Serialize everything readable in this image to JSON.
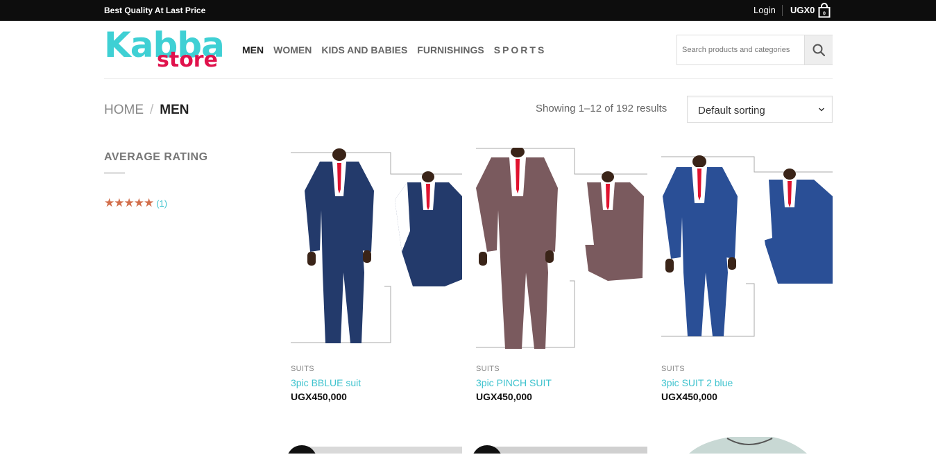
{
  "topbar": {
    "promo": "Best Quality At Last Price",
    "login": "Login",
    "cart_total": "UGX0",
    "cart_count": "0"
  },
  "logo": {
    "line1": "Kabba",
    "line2": "store"
  },
  "nav": [
    {
      "label": "MEN"
    },
    {
      "label": "WOMEN"
    },
    {
      "label": "KIDS AND BABIES"
    },
    {
      "label": "FURNISHINGS"
    },
    {
      "label": "SPORTS"
    }
  ],
  "search": {
    "placeholder": "Search products and categories"
  },
  "breadcrumb": {
    "home": "HOME",
    "separator": "/",
    "current": "MEN"
  },
  "results": {
    "showing": "Showing 1–12 of 192 results"
  },
  "sorting": {
    "selected": "Default sorting"
  },
  "sidebar": {
    "title": "AVERAGE RATING",
    "stars": "★★★★★",
    "count": "(1)"
  },
  "products": [
    {
      "category": "SUITS",
      "name": "3pic BBLUE suit",
      "price": "UGX450,000"
    },
    {
      "category": "SUITS",
      "name": "3pic PINCH SUIT",
      "price": "UGX450,000"
    },
    {
      "category": "SUITS",
      "name": "3pic SUIT 2 blue",
      "price": "UGX450,000"
    }
  ],
  "colors": {
    "accent": "#3fc3ce",
    "logo_teal": "#3fd0d4",
    "logo_red": "#e0124c",
    "star": "#d26e4b",
    "suit_navy": "#233a6b",
    "suit_mauve": "#7a5a5e",
    "suit_blue": "#2a4f96"
  }
}
